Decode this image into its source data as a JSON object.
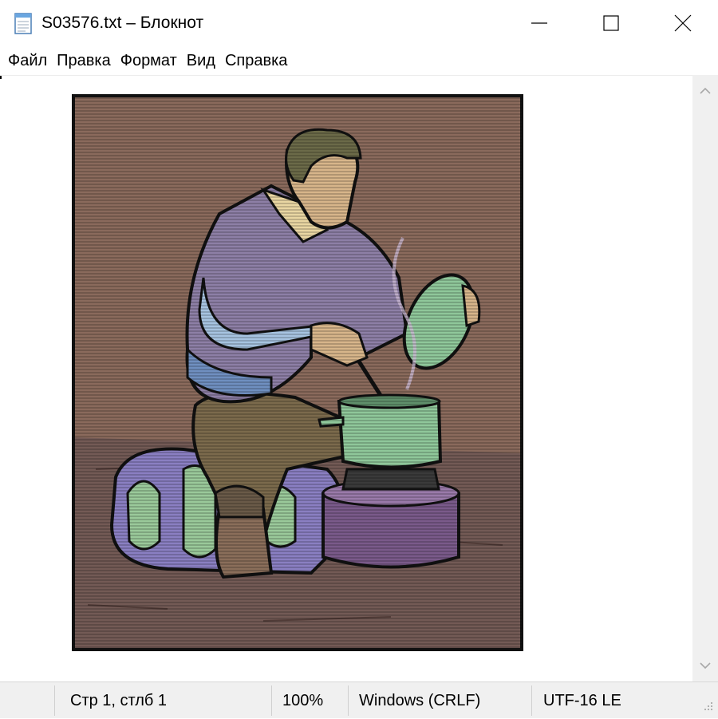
{
  "window": {
    "title": "S03576.txt – Блокнот",
    "icon": "notepad-icon"
  },
  "menu": [
    "Файл",
    "Правка",
    "Формат",
    "Вид",
    "Справка"
  ],
  "editor": {
    "content_image": "ascii-art-man-cooking-on-camp-stove"
  },
  "status": {
    "position": "Стр 1, стлб 1",
    "zoom": "100%",
    "line_endings": "Windows (CRLF)",
    "encoding": "UTF-16 LE"
  },
  "colors": {
    "background": "#8a6a5c",
    "sweater": "#8d7fa6",
    "pot": "#8fc79a",
    "stove": "#7a5a8a",
    "pants": "#7b6a4c"
  }
}
